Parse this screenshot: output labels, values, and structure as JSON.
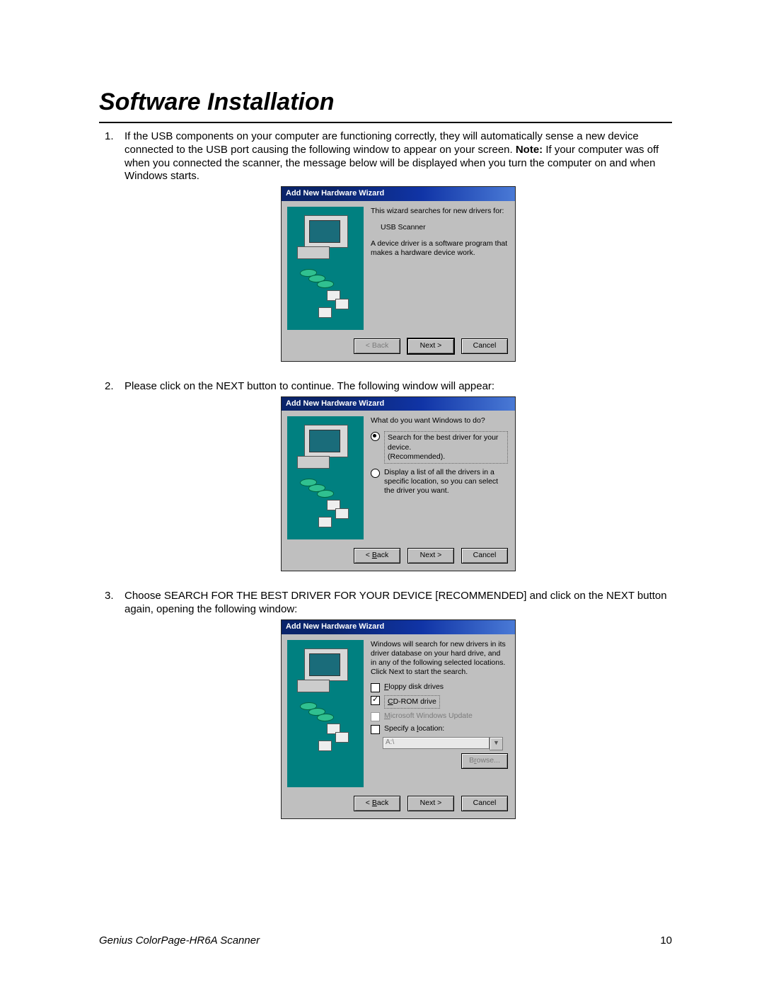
{
  "heading": "Software Installation",
  "item1_prefix": "If the USB components on your computer are functioning correctly, they will automatically sense a new device connected to the USB port causing the following window to appear on your screen. ",
  "item1_note_label": "Note:",
  "item1_suffix": " If your computer was off when you connected the scanner, the message below will be displayed when you turn the computer on and when Windows starts.",
  "item2": "Please click on the NEXT button to continue. The following window will appear:",
  "item3": "Choose SEARCH FOR THE BEST DRIVER FOR YOUR DEVICE [RECOMMENDED] and click on the NEXT button again, opening the following window:",
  "wizard_title": "Add New Hardware Wizard",
  "d1": {
    "line1": "This wizard searches for new drivers for:",
    "device": "USB Scanner",
    "line2": "A device driver is a software program that makes a hardware device work."
  },
  "d2": {
    "prompt": "What do you want Windows to do?",
    "opt1a": "Search for the best driver for your device.",
    "opt1b": "(Recommended).",
    "opt2": "Display a list of all the drivers in a specific location, so you can select the driver you want."
  },
  "d3": {
    "intro": "Windows will search for new drivers in its driver database on your hard drive, and in any of the following selected locations. Click Next to start the search.",
    "c1": "Floppy disk drives",
    "c2": "CD-ROM drive",
    "c3": "Microsoft Windows Update",
    "c4": "Specify a location:",
    "path": "A:\\"
  },
  "buttons": {
    "back": "< Back",
    "next": "Next >",
    "cancel": "Cancel",
    "browse": "Browse..."
  },
  "footer_product": "Genius ColorPage-HR6A Scanner",
  "footer_page": "10"
}
